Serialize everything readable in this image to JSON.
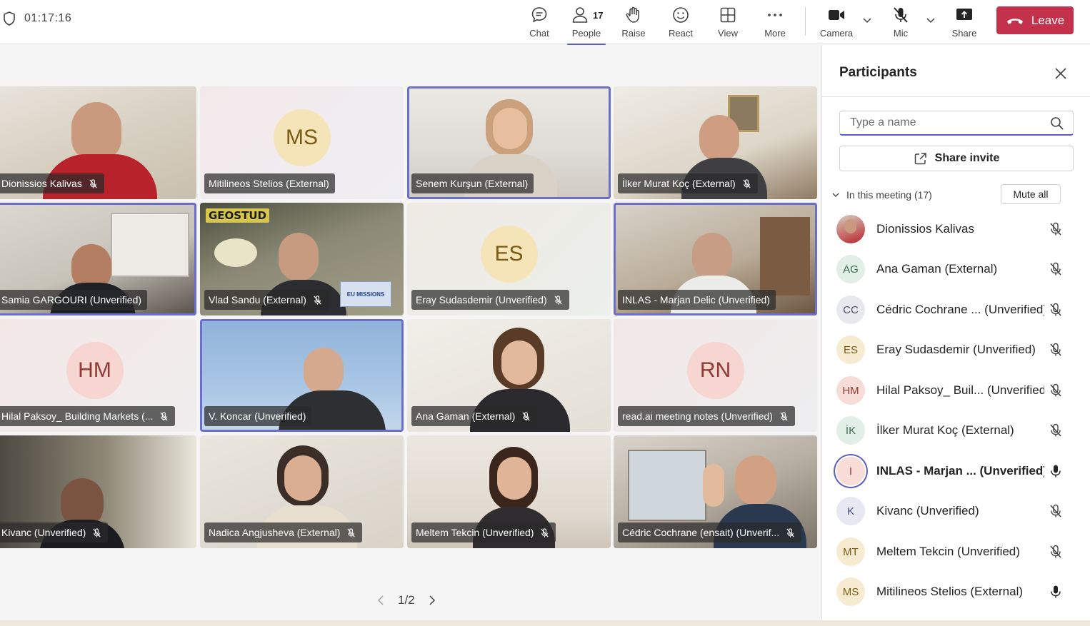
{
  "header": {
    "timer": "01:17:16",
    "tools": {
      "chat": "Chat",
      "people": "People",
      "people_count": "17",
      "raise": "Raise",
      "react": "React",
      "view": "View",
      "more": "More",
      "camera": "Camera",
      "mic": "Mic",
      "share": "Share"
    },
    "leave": "Leave"
  },
  "grid": {
    "tiles": [
      {
        "name": "Dionissios Kalivas",
        "muted": true
      },
      {
        "name": "Mitilineos Stelios (External)",
        "initials": "MS"
      },
      {
        "name": "Senem Kurşun (External)",
        "speaking": true
      },
      {
        "name": "İlker Murat Koç (External)",
        "muted": true
      },
      {
        "name": "Samia GARGOURI (Unverified)",
        "speaking": true
      },
      {
        "name": "Vlad Sandu (External)",
        "muted": true
      },
      {
        "name": "Eray Sudasdemir (Unverified)",
        "initials": "ES",
        "muted": true
      },
      {
        "name": "INLAS - Marjan Delic (Unverified)",
        "speaking": true
      },
      {
        "name": "Hilal Paksoy_ Building Markets (...",
        "initials": "HM",
        "muted": true
      },
      {
        "name": "V. Koncar (Unverified)",
        "speaking": true
      },
      {
        "name": "Ana Gaman (External)",
        "muted": true
      },
      {
        "name": "read.ai meeting notes (Unverified)",
        "initials": "RN",
        "muted": true
      },
      {
        "name": "Kivanc (Unverified)",
        "muted": true
      },
      {
        "name": "Nadica Angjusheva (External)",
        "muted": true
      },
      {
        "name": "Meltem Tekcin (Unverified)",
        "muted": true
      },
      {
        "name": "Cédric Cochrane (ensait) (Unverif...",
        "muted": true
      }
    ],
    "tile_logo_text": "GEOSTUD",
    "tile_banner_text": "EU MISSIONS",
    "pager": "1/2"
  },
  "panel": {
    "title": "Participants",
    "search_placeholder": "Type a name",
    "share_invite": "Share invite",
    "section_label": "In this meeting (17)",
    "mute_all": "Mute all",
    "participants": [
      {
        "name": "Dionissios Kalivas",
        "initials": "",
        "muted": true
      },
      {
        "name": "Ana Gaman (External)",
        "initials": "AG",
        "muted": true
      },
      {
        "name": "Cédric Cochrane ... (Unverified)",
        "initials": "CC",
        "muted": true
      },
      {
        "name": "Eray Sudasdemir (Unverified)",
        "initials": "ES",
        "muted": true
      },
      {
        "name": "Hilal Paksoy_ Buil... (Unverified)",
        "initials": "HM",
        "muted": true
      },
      {
        "name": "İlker Murat Koç (External)",
        "initials": "İK",
        "muted": true
      },
      {
        "name": "INLAS - Marjan ... (Unverified)",
        "initials": "I",
        "muted": false
      },
      {
        "name": "Kivanc (Unverified)",
        "initials": "K",
        "muted": true
      },
      {
        "name": "Meltem Tekcin (Unverified)",
        "initials": "MT",
        "muted": true
      },
      {
        "name": "Mitilineos Stelios (External)",
        "initials": "MS",
        "muted": false
      }
    ]
  },
  "colors": {
    "accent": "#5b5fc7",
    "leave": "#c4314b"
  }
}
